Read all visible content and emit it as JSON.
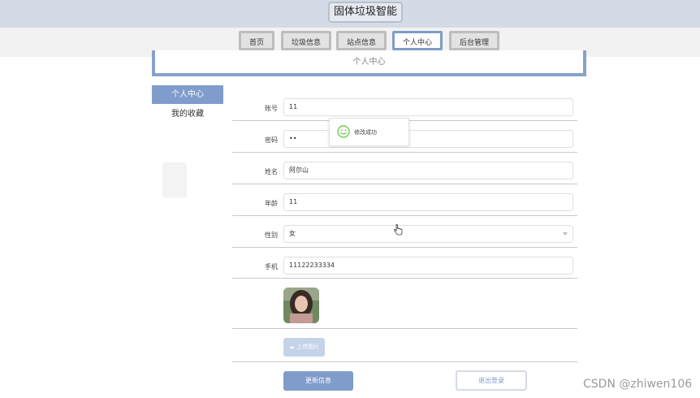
{
  "header": {
    "site_title": "固体垃圾智能"
  },
  "nav": {
    "items": [
      {
        "label": "首页"
      },
      {
        "label": "垃圾信息"
      },
      {
        "label": "站点信息"
      },
      {
        "label": "个人中心",
        "active": true
      },
      {
        "label": "后台管理"
      }
    ]
  },
  "page": {
    "heading": "个人中心"
  },
  "sidebar": {
    "items": [
      {
        "label": "个人中心",
        "active": true
      },
      {
        "label": "我的收藏"
      }
    ]
  },
  "form": {
    "account": {
      "label": "账号",
      "value": "11"
    },
    "password": {
      "label": "密码",
      "value": "••"
    },
    "name": {
      "label": "姓名",
      "value": "阿尔山"
    },
    "age": {
      "label": "年龄",
      "value": "11"
    },
    "gender": {
      "label": "性别",
      "value": "女"
    },
    "phone": {
      "label": "手机",
      "value": "11122233334"
    },
    "upload_label": "上传图片",
    "update_label": "更新信息",
    "logout_label": "退出登录"
  },
  "toast": {
    "message": "修改成功",
    "icon": "smile-icon"
  },
  "watermark": "CSDN @zhiwen106",
  "colors": {
    "accent": "#7f9ccb",
    "topbar": "#d4dae6",
    "success": "#67c23a"
  }
}
